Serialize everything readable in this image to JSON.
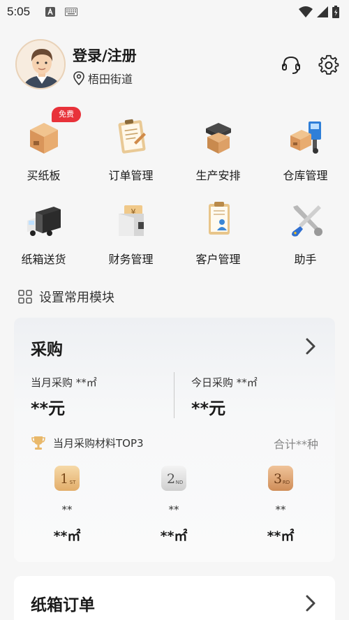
{
  "status_bar": {
    "time": "5:05"
  },
  "header": {
    "login_label": "登录/注册",
    "location": "梧田街道",
    "icons": [
      "customer-service-icon",
      "settings-gear-icon"
    ]
  },
  "modules": [
    {
      "label": "买纸板",
      "icon": "cardboard-box-icon",
      "badge": "免费"
    },
    {
      "label": "订单管理",
      "icon": "order-clipboard-icon"
    },
    {
      "label": "生产安排",
      "icon": "production-box-icon"
    },
    {
      "label": "仓库管理",
      "icon": "warehouse-forklift-icon"
    },
    {
      "label": "纸箱送货",
      "icon": "delivery-truck-icon"
    },
    {
      "label": "财务管理",
      "icon": "finance-wallet-icon"
    },
    {
      "label": "客户管理",
      "icon": "customer-document-icon"
    },
    {
      "label": "助手",
      "icon": "tools-wrench-icon"
    }
  ],
  "setting_row": {
    "label": "设置常用模块"
  },
  "purchase_card": {
    "title": "采购",
    "month_label": "当月采购 **㎡",
    "month_value": "**元",
    "today_label": "今日采购 **㎡",
    "today_value": "**元",
    "top3_label": "当月采购材料TOP3",
    "total": "合计**种",
    "ranks": [
      {
        "rank": "1",
        "suffix": "ST",
        "name": "**",
        "area": "**㎡",
        "color": "#e6b77a"
      },
      {
        "rank": "2",
        "suffix": "ND",
        "name": "**",
        "area": "**㎡",
        "color": "#c9c9c9"
      },
      {
        "rank": "3",
        "suffix": "RD",
        "name": "**",
        "area": "**㎡",
        "color": "#d49a6a"
      }
    ]
  },
  "order_card": {
    "title": "纸箱订单"
  }
}
